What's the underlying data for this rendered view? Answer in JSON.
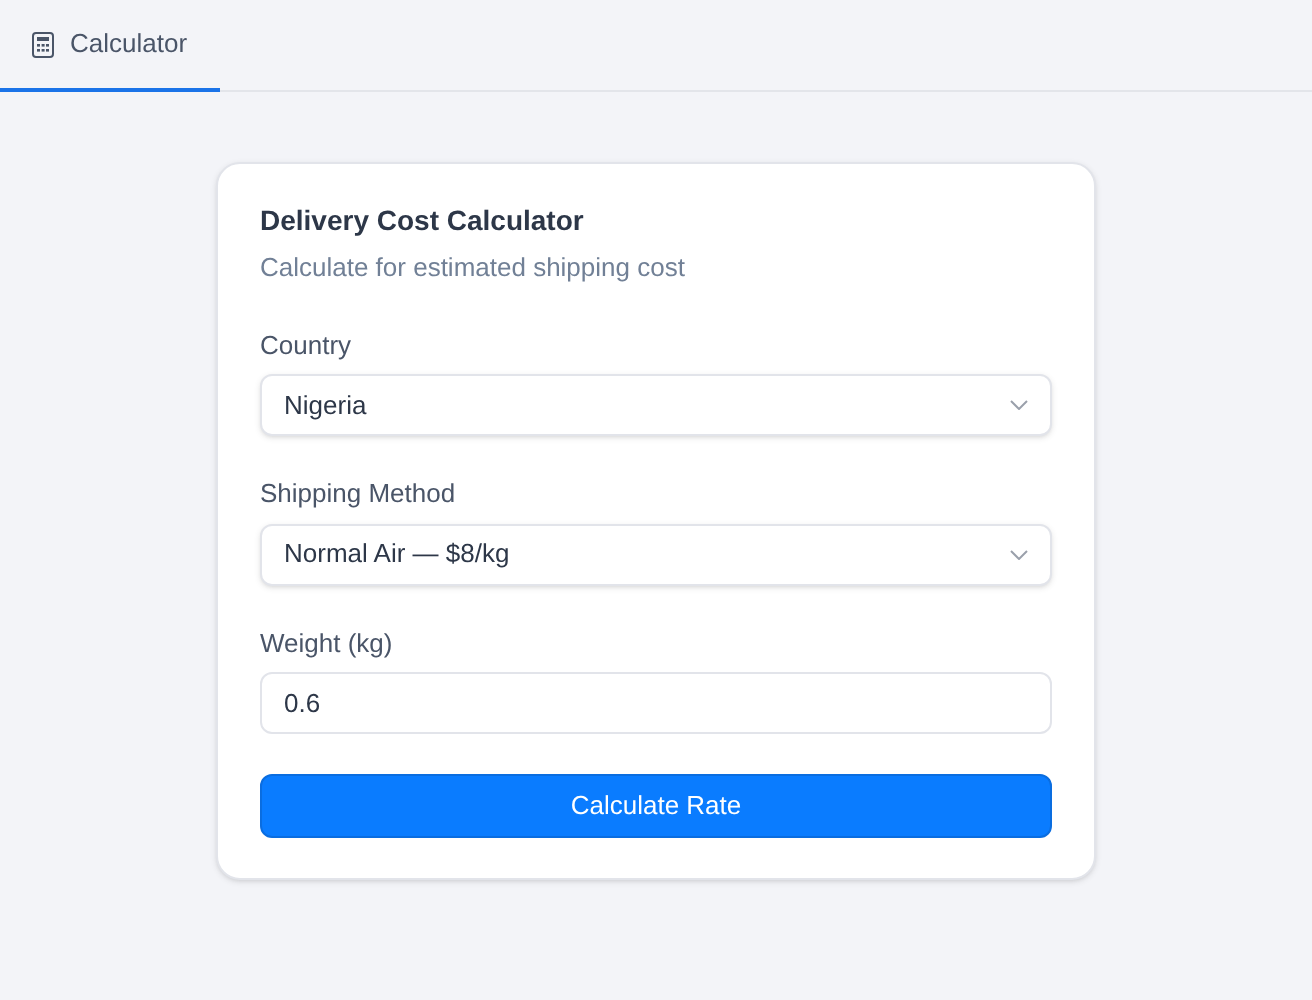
{
  "tabs": [
    {
      "label": "Calculator",
      "selected": true
    }
  ],
  "card": {
    "title": "Delivery Cost Calculator",
    "subtitle": "Calculate for estimated shipping cost",
    "fields": [
      {
        "kind": "select",
        "label": "Country",
        "value": "Nigeria"
      },
      {
        "kind": "select",
        "label": "Shipping Method",
        "value": "Normal Air — $8/kg"
      },
      {
        "kind": "input",
        "label": "Weight (kg)",
        "value": "0.6"
      }
    ],
    "button": "Calculate Rate"
  }
}
